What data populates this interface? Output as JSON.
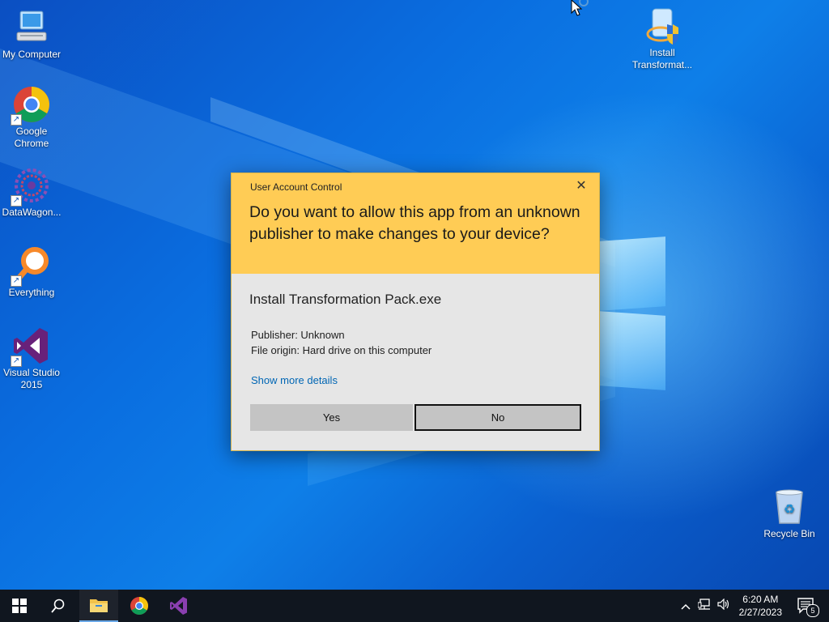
{
  "desktop": {
    "icons": [
      {
        "label": "My Computer"
      },
      {
        "label": "Google Chrome"
      },
      {
        "label": "DataWagon..."
      },
      {
        "label": "Everything"
      },
      {
        "label": "Visual Studio 2015"
      },
      {
        "label": "Install Transformat..."
      },
      {
        "label": "Recycle Bin"
      }
    ]
  },
  "uac": {
    "window_title": "User Account Control",
    "question": "Do you want to allow this app from an unknown publisher to make changes to your device?",
    "app_name": "Install Transformation Pack.exe",
    "publisher": "Publisher: Unknown",
    "file_origin": "File origin: Hard drive on this computer",
    "details_link": "Show more details",
    "yes_label": "Yes",
    "no_label": "No",
    "header_color": "#FFCC55"
  },
  "taskbar": {
    "apps": [
      "start-icon",
      "search-icon",
      "file-explorer-icon",
      "chrome-icon",
      "visual-studio-icon"
    ],
    "time": "6:20 AM",
    "date": "2/27/2023",
    "notification_count": "5"
  }
}
